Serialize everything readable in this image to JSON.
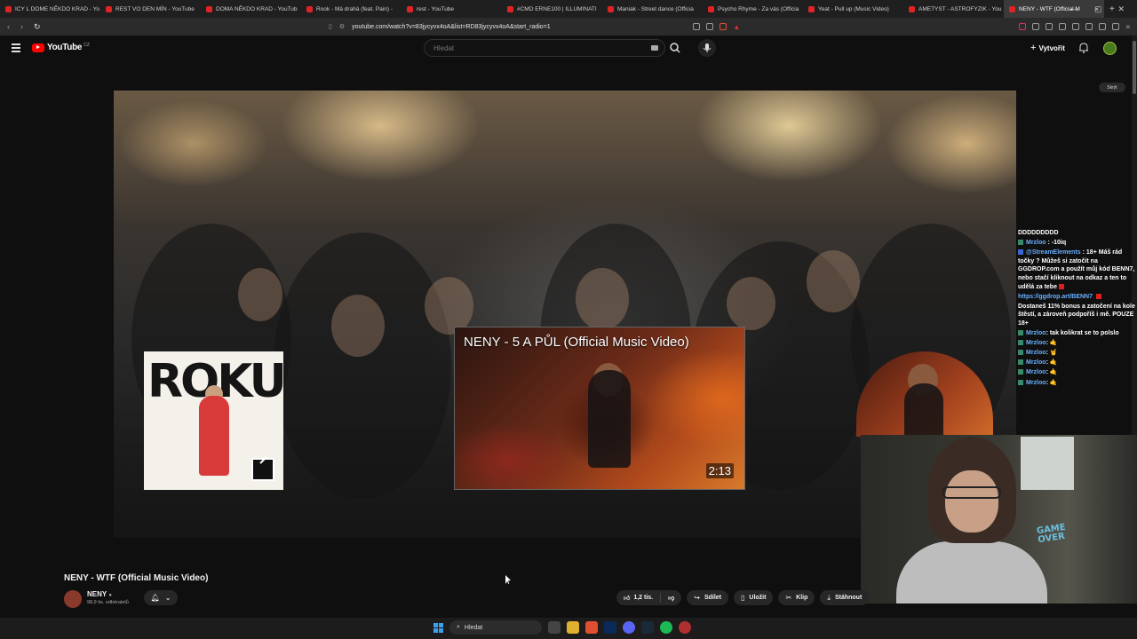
{
  "browser": {
    "tabs": [
      {
        "title": "ICY L DOME NĚKDO KRAD - Yo",
        "active": false
      },
      {
        "title": "REST VO DEN MÍN - YouTube",
        "active": false
      },
      {
        "title": "DOMA NĚKDO KRAD - YouTub",
        "active": false
      },
      {
        "title": "Rook - Má drahá (feat. Pain) -",
        "active": false
      },
      {
        "title": "rest - YouTube",
        "active": false
      },
      {
        "title": "#CMD ERNE100 | ILLUMINATI",
        "active": false
      },
      {
        "title": "Maniak - Street dance (Officia",
        "active": false
      },
      {
        "title": "Psycho Rhyme - Za vás (Officia",
        "active": false
      },
      {
        "title": "Yeat - Pull up (Music Video)",
        "active": false
      },
      {
        "title": "AMETYST - ASTROFYZIK - You",
        "active": false
      },
      {
        "title": "NENY - WTF (Official M",
        "active": true
      }
    ],
    "url": "youtube.com/watch?v=83jycyvx4oA&list=RD83jycyvx4oA&start_radio=1"
  },
  "youtube": {
    "logo_text": "YouTube",
    "region": "CZ",
    "search_placeholder": "Hledat",
    "create_label": "Vytvořit"
  },
  "player": {
    "hide_chip": "Skrýt",
    "album_card_text": "ROKU",
    "endscreen_video_title": "NENY - 5 A PŮL (Official Music Video)",
    "endscreen_video_duration": "2:13"
  },
  "chat": {
    "lines": [
      {
        "user": "",
        "text": "DDDDDDDDD"
      },
      {
        "user": "Mrzloo",
        "text": ": -10iq"
      },
      {
        "user": "@StreamElements",
        "text": ": 18+ Máš rád točky ? Můžeš si zatočit na GGDROP.com a použít můj kód BENN7, nebo stačí kliknout na odkaz a ten to udělá za tebe"
      },
      {
        "user": "",
        "text": "https://ggdrop.art/BENN7"
      },
      {
        "user": "",
        "text": "Dostaneš 11% bonus a zatočení na kole štěstí, a zároveň podpoříš i mě. POUZE 18+"
      },
      {
        "user": "Mrzloo",
        "text": ": tak kolikrat se to polslo"
      },
      {
        "user": "Mrzloo",
        "text": ":"
      },
      {
        "user": "Mrzloo",
        "text": ":"
      },
      {
        "user": "Mrzloo",
        "text": ":"
      },
      {
        "user": "Mrzloo",
        "text": ":"
      },
      {
        "user": "Mrzloo",
        "text": ":"
      }
    ]
  },
  "webcam": {
    "poster_text": "GAME OVER"
  },
  "video_info": {
    "title": "NENY - WTF (Official Music Video)",
    "channel": "NENY",
    "subscribers": "98,9 tis. odběratelů",
    "likes": "1,2 tis.",
    "share_label": "Sdílet",
    "save_label": "Uložit",
    "clip_label": "Klip",
    "download_label": "Stáhnout"
  },
  "taskbar": {
    "search_label": "Hledat"
  },
  "colors": {
    "youtube_red": "#ff0000",
    "page_bg": "#0f0f0f",
    "chat_user": "#6ab0ff"
  }
}
